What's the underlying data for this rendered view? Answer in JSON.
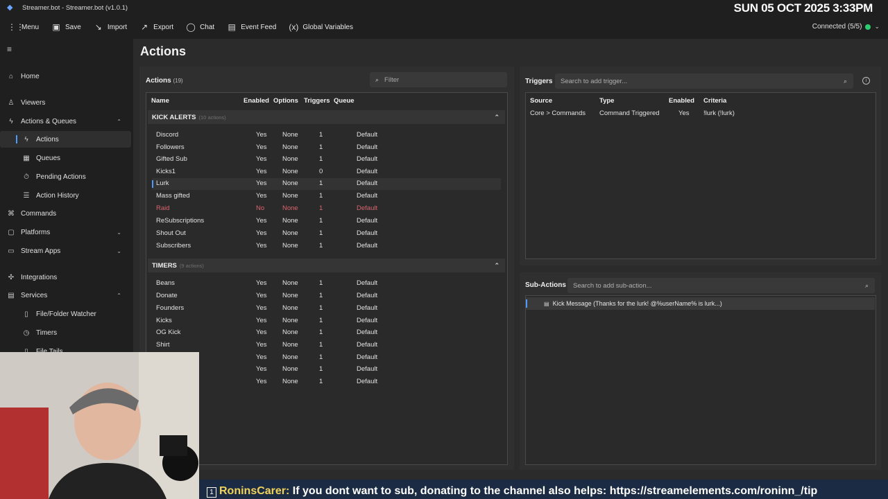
{
  "window": {
    "title": "Streamer.bot - Streamer.bot (v1.0.1)",
    "overlay_clock": "SUN 05 OCT 2025 3:33PM"
  },
  "toolbar": {
    "items": [
      {
        "label": "Menu",
        "icon": "grid-icon"
      },
      {
        "label": "Save",
        "icon": "save-icon"
      },
      {
        "label": "Import",
        "icon": "import-icon"
      },
      {
        "label": "Export",
        "icon": "export-icon"
      },
      {
        "label": "Chat",
        "icon": "chat-icon"
      },
      {
        "label": "Event Feed",
        "icon": "event-feed-icon"
      },
      {
        "label": "Global Variables",
        "icon": "variables-icon"
      }
    ],
    "connection": "Connected (5/5)",
    "connection_color": "#2ecc71"
  },
  "sidebar": {
    "items": [
      {
        "label": "Home",
        "icon": "home-icon"
      },
      {
        "label": "Viewers",
        "icon": "viewers-icon"
      },
      {
        "label": "Actions & Queues",
        "icon": "bolt-icon"
      },
      {
        "label": "Actions",
        "icon": "bolt-icon"
      },
      {
        "label": "Queues",
        "icon": "queue-icon"
      },
      {
        "label": "Pending Actions",
        "icon": "pending-icon"
      },
      {
        "label": "Action History",
        "icon": "history-icon"
      },
      {
        "label": "Commands",
        "icon": "command-icon"
      },
      {
        "label": "Platforms",
        "icon": "platforms-icon"
      },
      {
        "label": "Stream Apps",
        "icon": "apps-icon"
      },
      {
        "label": "Integrations",
        "icon": "integrations-icon"
      },
      {
        "label": "Services",
        "icon": "services-icon"
      },
      {
        "label": "File/Folder Watcher",
        "icon": "file-icon"
      },
      {
        "label": "Timers",
        "icon": "timer-icon"
      },
      {
        "label": "File Tails",
        "icon": "file-icon"
      }
    ]
  },
  "main": {
    "title": "Actions"
  },
  "actions": {
    "label": "Actions",
    "count": "(19)",
    "filter_placeholder": "Filter",
    "columns": [
      "Name",
      "Enabled",
      "Options",
      "Triggers",
      "Queue"
    ],
    "groups": [
      {
        "name": "KICK ALERTS",
        "count": "(10 actions)",
        "rows": [
          [
            "Discord",
            "Yes",
            "None",
            "1",
            "Default"
          ],
          [
            "Followers",
            "Yes",
            "None",
            "1",
            "Default"
          ],
          [
            "Gifted Sub",
            "Yes",
            "None",
            "1",
            "Default"
          ],
          [
            "Kicks1",
            "Yes",
            "None",
            "0",
            "Default"
          ],
          [
            "Lurk",
            "Yes",
            "None",
            "1",
            "Default"
          ],
          [
            "Mass gifted",
            "Yes",
            "None",
            "1",
            "Default"
          ],
          [
            "Raid",
            "No",
            "None",
            "1",
            "Default"
          ],
          [
            "ReSubscriptions",
            "Yes",
            "None",
            "1",
            "Default"
          ],
          [
            "Shout Out",
            "Yes",
            "None",
            "1",
            "Default"
          ],
          [
            "Subscribers",
            "Yes",
            "None",
            "1",
            "Default"
          ]
        ]
      },
      {
        "name": "TIMERS",
        "count": "(9 actions)",
        "rows": [
          [
            "Beans",
            "Yes",
            "None",
            "1",
            "Default"
          ],
          [
            "Donate",
            "Yes",
            "None",
            "1",
            "Default"
          ],
          [
            "Founders",
            "Yes",
            "None",
            "1",
            "Default"
          ],
          [
            "Kicks",
            "Yes",
            "None",
            "1",
            "Default"
          ],
          [
            "OG Kick",
            "Yes",
            "None",
            "1",
            "Default"
          ],
          [
            "Shirt",
            "Yes",
            "None",
            "1",
            "Default"
          ],
          [
            "",
            "Yes",
            "None",
            "1",
            "Default"
          ],
          [
            "",
            "Yes",
            "None",
            "1",
            "Default"
          ],
          [
            "",
            "Yes",
            "None",
            "1",
            "Default"
          ]
        ]
      }
    ],
    "disabled_color": "#d9646e",
    "accent": "#4d9bff"
  },
  "triggers": {
    "label": "Triggers",
    "search_placeholder": "Search to add trigger...",
    "columns": [
      "Source",
      "Type",
      "Enabled",
      "Criteria"
    ],
    "rows": [
      [
        "Core > Commands",
        "Command Triggered",
        "Yes",
        "!lurk (!lurk)"
      ]
    ]
  },
  "sub_actions": {
    "label": "Sub-Actions",
    "search_placeholder": "Search to add sub-action...",
    "items": [
      "Kick Message (Thanks for the lurk! @%userName% is lurk...)"
    ]
  },
  "overlay": {
    "ticker_user": "RoninsCarer:",
    "ticker_text": " If you dont want to sub, donating to the channel also helps: https://streamelements.com/roninn_/tip",
    "ticker_badge": "1"
  }
}
